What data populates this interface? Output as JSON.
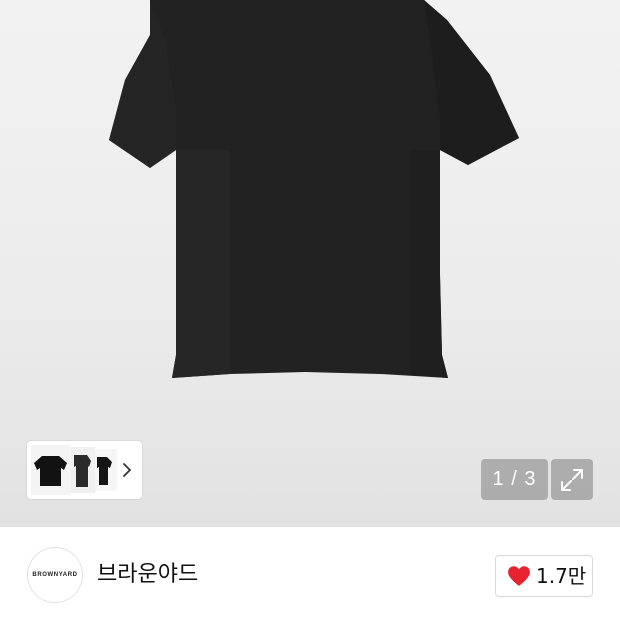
{
  "gallery": {
    "product_image": "black-oversized-t-shirt",
    "thumbnails": [
      "black-t-shirt-front",
      "black-t-shirt-side",
      "black-t-shirt-back"
    ],
    "next_icon": "chevron-right-icon",
    "counter": "1 / 3",
    "expand_icon": "expand-icon"
  },
  "brand": {
    "logo_text": "BROWNYARD",
    "name": "브라운야드"
  },
  "like": {
    "icon": "heart-icon",
    "color": "#e8232f",
    "count": "1.7만"
  }
}
